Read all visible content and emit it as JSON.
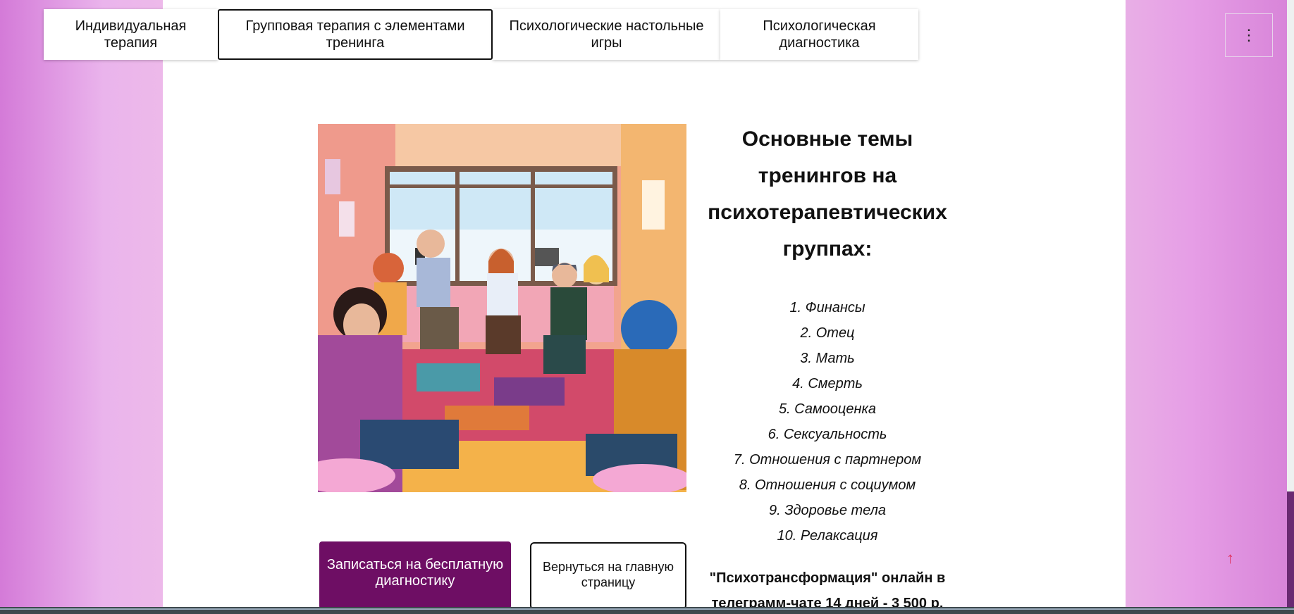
{
  "nav": {
    "tabs": [
      {
        "label": "Индивидуальная\nтерапия",
        "active": false
      },
      {
        "label": "Групповая терапия с элементами\nтренинга",
        "active": true
      },
      {
        "label": "Психологические настольные\nигры",
        "active": false
      },
      {
        "label": "Психологическая\nдиагностика",
        "active": false
      }
    ],
    "menu_icon": "⋮"
  },
  "hero_image": {
    "icon": "group-therapy-illustration"
  },
  "content": {
    "heading": "Основные темы тренингов на психотерапевтических группах:",
    "topics": [
      "1. Финансы",
      "2. Отец",
      "3. Мать",
      "4. Смерть",
      "5. Самооценка",
      "6. Сексуальность",
      "7. Отношения с партнером",
      "8. Отношения с социумом",
      "9. Здоровье тела",
      "10. Релаксация"
    ],
    "promo": "\"Психотрансформация\" онлайн в телеграмм-чате 14 дней - 3 500 р."
  },
  "buttons": {
    "signup": "Записаться на бесплатную диагностику",
    "back": "Вернуться на главную страницу"
  },
  "scroll_top": "↑",
  "colors": {
    "primary": "#6e0e64",
    "background_left": "#d47ad8",
    "background_right": "#d783d8"
  }
}
